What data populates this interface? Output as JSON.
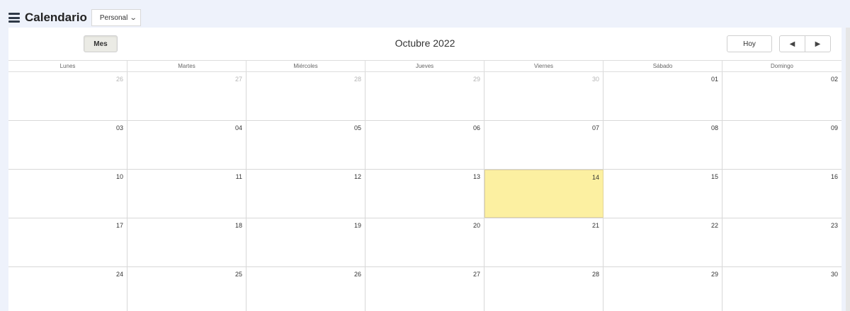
{
  "header": {
    "title": "Calendario",
    "calendar_select": "Personal"
  },
  "toolbar": {
    "month_view_label": "Mes",
    "today_label": "Hoy",
    "prev_symbol": "◀",
    "next_symbol": "▶",
    "period_title": "Octubre 2022"
  },
  "weekdays": [
    "Lunes",
    "Martes",
    "Miércoles",
    "Jueves",
    "Viernes",
    "Sábado",
    "Domingo"
  ],
  "weeks": [
    [
      {
        "d": "26",
        "other": true
      },
      {
        "d": "27",
        "other": true
      },
      {
        "d": "28",
        "other": true
      },
      {
        "d": "29",
        "other": true
      },
      {
        "d": "30",
        "other": true
      },
      {
        "d": "01"
      },
      {
        "d": "02"
      }
    ],
    [
      {
        "d": "03"
      },
      {
        "d": "04"
      },
      {
        "d": "05"
      },
      {
        "d": "06"
      },
      {
        "d": "07"
      },
      {
        "d": "08"
      },
      {
        "d": "09"
      }
    ],
    [
      {
        "d": "10"
      },
      {
        "d": "11"
      },
      {
        "d": "12"
      },
      {
        "d": "13"
      },
      {
        "d": "14",
        "today": true
      },
      {
        "d": "15"
      },
      {
        "d": "16"
      }
    ],
    [
      {
        "d": "17"
      },
      {
        "d": "18"
      },
      {
        "d": "19"
      },
      {
        "d": "20"
      },
      {
        "d": "21"
      },
      {
        "d": "22"
      },
      {
        "d": "23"
      }
    ],
    [
      {
        "d": "24"
      },
      {
        "d": "25"
      },
      {
        "d": "26"
      },
      {
        "d": "27"
      },
      {
        "d": "28"
      },
      {
        "d": "29"
      },
      {
        "d": "30"
      }
    ]
  ],
  "colors": {
    "today_highlight": "#fcf0a1",
    "background": "#eef2fb"
  }
}
